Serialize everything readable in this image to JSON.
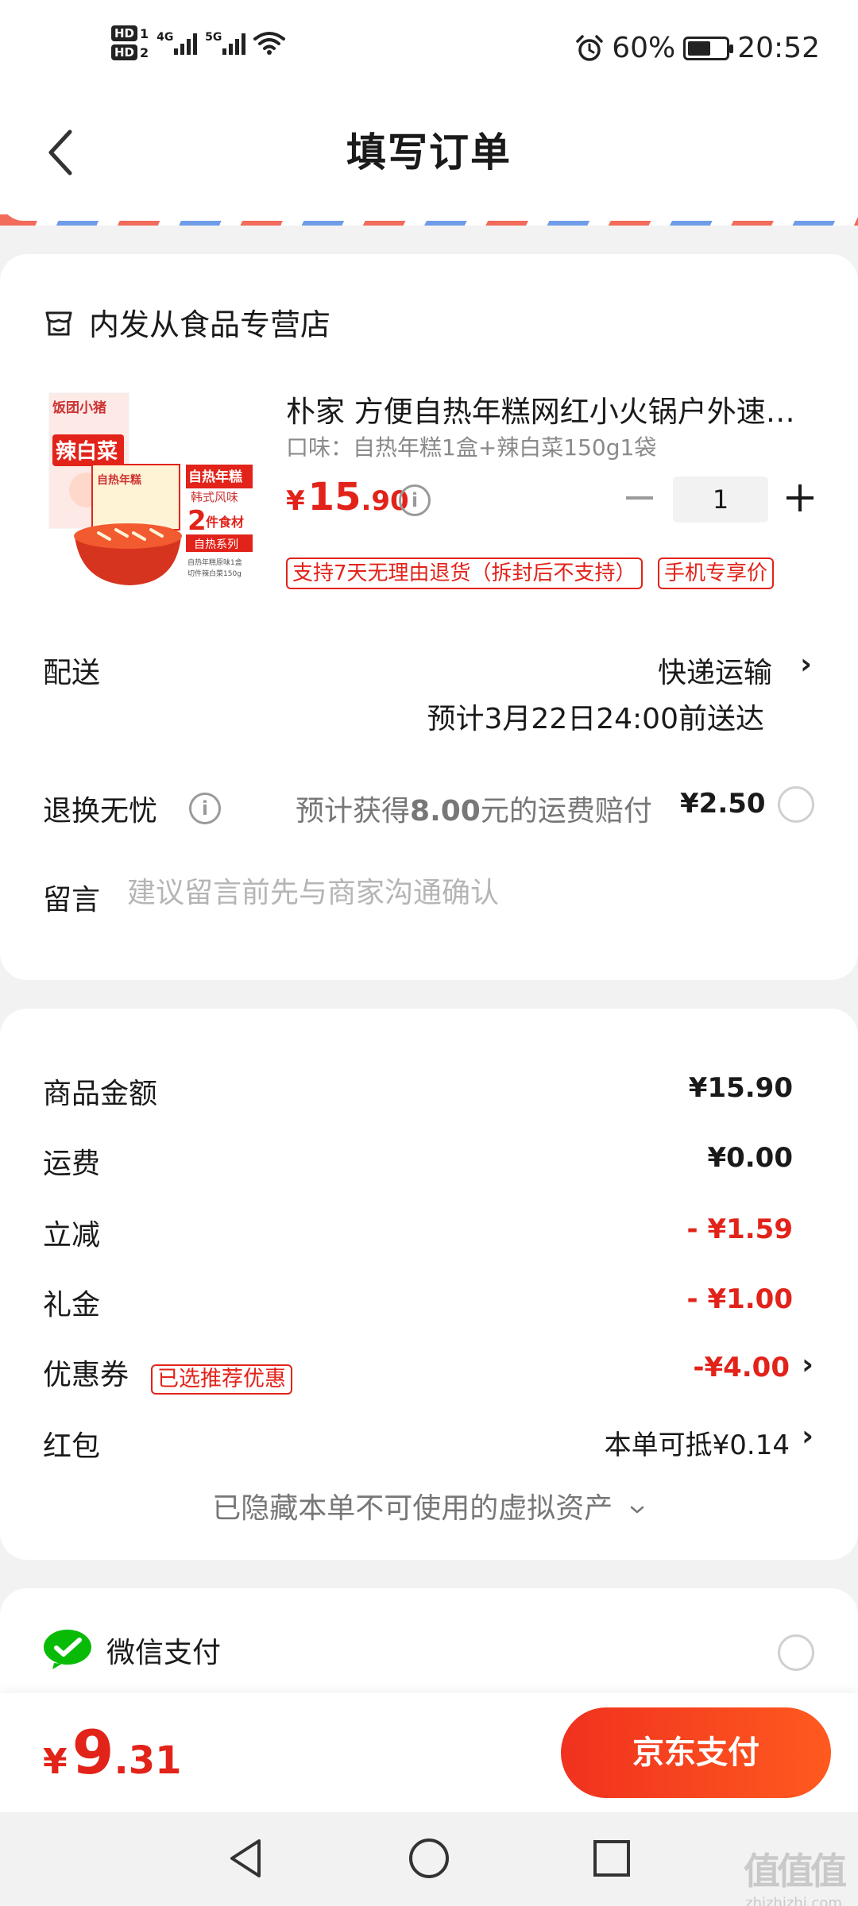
{
  "status_bar": {
    "hd1": "HD",
    "sim1": "1",
    "hd2": "HD",
    "sim2": "2",
    "net1": "4G",
    "net2": "5G",
    "battery_pct": "60%",
    "battery_level": 0.6,
    "time": "20:52",
    "icons": [
      "alarm-icon",
      "wifi-icon",
      "battery-icon"
    ]
  },
  "header": {
    "title": "填写订单"
  },
  "order": {
    "store_name": "内发从食品专营店",
    "product": {
      "title": "朴家 方便自热年糕网红小火锅户外速食韩式拉面韩国",
      "spec": "口味：自热年糕1盒+辣白菜150g1袋",
      "price_currency": "¥",
      "price_int": "15",
      "price_dec": ".90",
      "quantity": "1",
      "tags": [
        "支持7天无理由退货（拆封后不支持）",
        "手机专享价"
      ],
      "image_texts": {
        "brand": "饭团小猪",
        "kimchi": "辣白菜",
        "self_heat": "自热年糕",
        "korean": "韩式风味",
        "two": "2",
        "ingredients": "件食材",
        "series": "自热系列",
        "pack_label": "自热年糕",
        "desc1": "自热年糕原味1盒",
        "desc2": "切件辣白菜150g"
      }
    },
    "delivery": {
      "label": "配送",
      "method": "快递运输",
      "eta": "预计3月22日24:00前送达"
    },
    "return_service": {
      "label": "退换无忧",
      "desc_pre": "预计获得",
      "desc_amount": "8.00",
      "desc_post": "元的运费赔付",
      "price": "¥2.50"
    },
    "message": {
      "label": "留言",
      "placeholder": "建议留言前先与商家沟通确认"
    }
  },
  "summary": {
    "goods_label": "商品金额",
    "goods_value": "¥15.90",
    "shipping_label": "运费",
    "shipping_value": "¥0.00",
    "instant_label": "立减",
    "instant_value": "- ¥1.59",
    "gift_label": "礼金",
    "gift_value": "- ¥1.00",
    "coupon_label": "优惠券",
    "coupon_tag": "已选推荐优惠",
    "coupon_value": "-¥4.00",
    "redpacket_label": "红包",
    "redpacket_value": "本单可抵¥0.14",
    "hidden_assets": "已隐藏本单不可使用的虚拟资产"
  },
  "payment": {
    "wechat_label": "微信支付"
  },
  "footer": {
    "total_currency": "¥",
    "total_int": "9",
    "total_dec": ".31",
    "pay_button": "京东支付"
  },
  "watermark": {
    "logo": "值值值",
    "url": "zhizhizhi.com"
  },
  "colors": {
    "accent": "#e2231a",
    "pay_gradient_start": "#f0311f",
    "pay_gradient_end": "#ff5a1f",
    "wechat_green": "#09bb07"
  }
}
